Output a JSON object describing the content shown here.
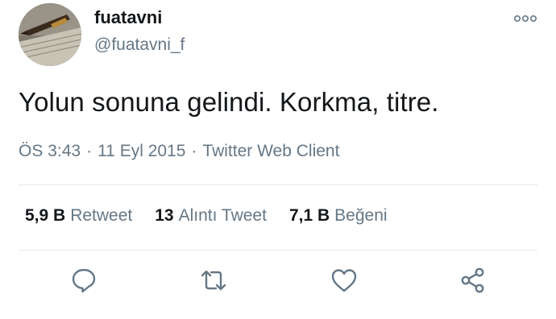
{
  "header": {
    "display_name": "fuatavni",
    "handle": "@fuatavni_f",
    "more_icon": "more-dots-icon"
  },
  "tweet": {
    "text": "Yolun sonuna gelindi. Korkma, titre."
  },
  "meta": {
    "time": "ÖS 3:43",
    "separator": "·",
    "date": "11 Eyl 2015",
    "source": "Twitter Web Client"
  },
  "stats": [
    {
      "count": "5,9 B",
      "label": "Retweet"
    },
    {
      "count": "13",
      "label": "Alıntı Tweet"
    },
    {
      "count": "7,1 B",
      "label": "Beğeni"
    }
  ],
  "actions": {
    "reply_icon": "reply-icon",
    "retweet_icon": "retweet-icon",
    "like_icon": "heart-icon",
    "share_icon": "share-icon"
  },
  "colors": {
    "text": "#14171a",
    "secondary": "#657786",
    "icon": "#657786",
    "divider": "#e1e8ed"
  }
}
